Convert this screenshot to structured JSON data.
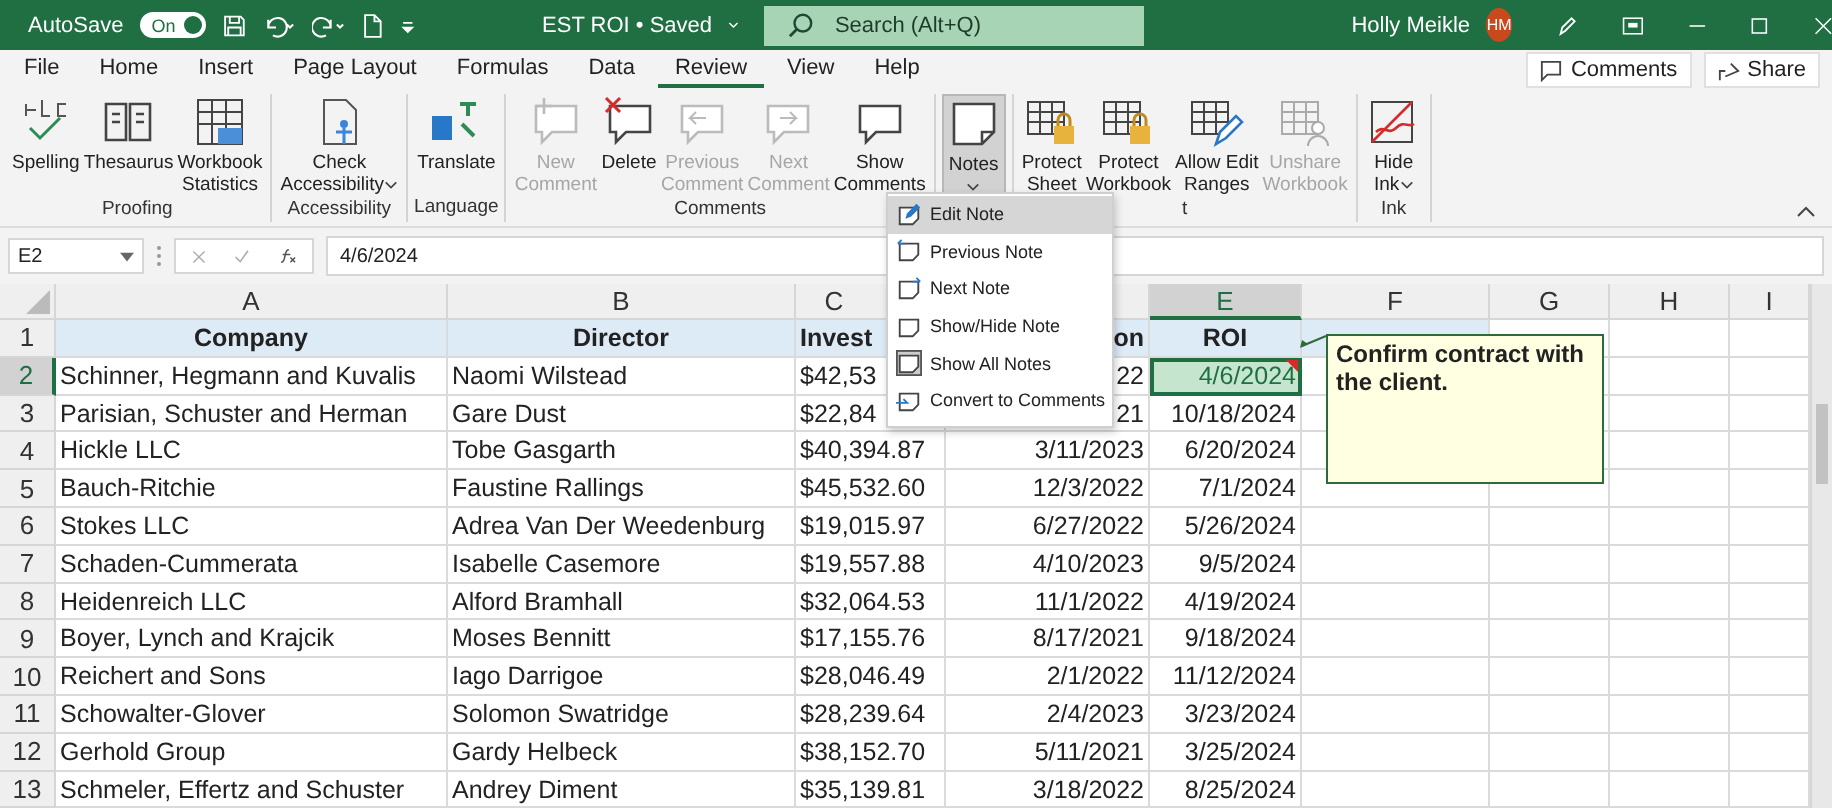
{
  "title_bar": {
    "autosave_label": "AutoSave",
    "autosave": {
      "on": true,
      "label": "On"
    },
    "doc_title": "EST ROI • Saved",
    "search_placeholder": "Search (Alt+Q)",
    "user_name": "Holly Meikle",
    "user_initials": "HM"
  },
  "tabs": [
    {
      "label": "File",
      "selected": false
    },
    {
      "label": "Home",
      "selected": false
    },
    {
      "label": "Insert",
      "selected": false
    },
    {
      "label": "Page Layout",
      "selected": false
    },
    {
      "label": "Formulas",
      "selected": false
    },
    {
      "label": "Data",
      "selected": false
    },
    {
      "label": "Review",
      "selected": true
    },
    {
      "label": "View",
      "selected": false
    },
    {
      "label": "Help",
      "selected": false
    }
  ],
  "actions": [
    {
      "label": "Comments",
      "kind": "comments"
    },
    {
      "label": "Share",
      "kind": "share"
    }
  ],
  "ribbon_groups": [
    {
      "label": "Proofing",
      "buttons": [
        {
          "lines": [
            "Spelling"
          ],
          "kind": "spelling",
          "disabled": false
        },
        {
          "lines": [
            "Thesaurus"
          ],
          "kind": "thesaurus",
          "disabled": false
        },
        {
          "lines": [
            "Workbook",
            "Statistics"
          ],
          "kind": "stats",
          "disabled": false
        }
      ]
    },
    {
      "label": "Accessibility",
      "buttons": [
        {
          "lines": [
            "Check",
            "Accessibility"
          ],
          "kind": "accessibility",
          "disabled": false,
          "dropdown": true
        }
      ]
    },
    {
      "label": "Language",
      "buttons": [
        {
          "lines": [
            "Translate"
          ],
          "kind": "translate",
          "disabled": false
        }
      ]
    },
    {
      "label": "Comments",
      "buttons": [
        {
          "lines": [
            "New",
            "Comment"
          ],
          "kind": "comment-new",
          "disabled": true
        },
        {
          "lines": [
            "Delete"
          ],
          "kind": "comment-delete",
          "disabled": false
        },
        {
          "lines": [
            "Previous",
            "Comment"
          ],
          "kind": "comment-prev",
          "disabled": true
        },
        {
          "lines": [
            "Next",
            "Comment"
          ],
          "kind": "comment-next",
          "disabled": true
        },
        {
          "lines": [
            "Show",
            "Comments"
          ],
          "kind": "comment-show",
          "disabled": false
        }
      ]
    },
    {
      "buttons": [
        {
          "lines": [
            "Notes"
          ],
          "kind": "note",
          "disabled": false,
          "dropdown": true,
          "pressed": true
        }
      ]
    },
    {
      "label": "t",
      "buttons": [
        {
          "lines": [
            "Protect",
            "Sheet"
          ],
          "kind": "protect-sheet",
          "disabled": false
        },
        {
          "lines": [
            "Protect",
            "Workbook"
          ],
          "kind": "protect-workbook",
          "disabled": false
        },
        {
          "lines": [
            "Allow Edit",
            "Ranges"
          ],
          "kind": "allow-edit",
          "disabled": false
        },
        {
          "lines": [
            "Unshare",
            "Workbook"
          ],
          "kind": "unshare",
          "disabled": true
        }
      ]
    },
    {
      "label": "Ink",
      "buttons": [
        {
          "lines": [
            "Hide",
            "Ink"
          ],
          "kind": "ink",
          "disabled": false,
          "dropdown": true
        }
      ]
    }
  ],
  "notes_menu": [
    {
      "label": "Edit Note",
      "kind": "edit",
      "selected": true
    },
    {
      "label": "Previous Note",
      "kind": "previous",
      "selected": false
    },
    {
      "label": "Next Note",
      "kind": "next",
      "selected": false
    },
    {
      "label": "Show/Hide Note",
      "kind": "show-hide",
      "selected": false
    },
    {
      "label": "Show All Notes",
      "kind": "show-all",
      "selected": false
    },
    {
      "label": "Convert to Comments",
      "kind": "convert",
      "selected": false
    }
  ],
  "formula_bar": {
    "name_box": "E2",
    "value": "4/6/2024"
  },
  "columns": [
    {
      "letter": "A",
      "selected": false
    },
    {
      "letter": "B",
      "selected": false
    },
    {
      "letter": "C",
      "selected": false
    },
    {
      "selected": false
    },
    {
      "letter": "E",
      "selected": true
    },
    {
      "letter": "F",
      "selected": false
    },
    {
      "letter": "G",
      "selected": false
    },
    {
      "letter": "H",
      "selected": false
    },
    {
      "letter": "I",
      "selected": false
    }
  ],
  "rows": [
    {
      "num": "1",
      "selected": false,
      "kind": "header",
      "cells": [
        "Company",
        "Director",
        "Invest",
        "on",
        "ROI"
      ]
    },
    {
      "num": "2",
      "selected": true,
      "cells": [
        "Schinner, Hegmann and Kuvalis",
        "Naomi Wilstead",
        "$42,53",
        "22",
        {
          "text": "4/6/2024",
          "note": true
        }
      ]
    },
    {
      "num": "3",
      "selected": false,
      "cells": [
        "Parisian, Schuster and Herman",
        "Gare Dust",
        "$22,84",
        "21",
        "10/18/2024"
      ]
    },
    {
      "num": "4",
      "selected": false,
      "cells": [
        "Hickle LLC",
        "Tobe Gasgarth",
        "$40,394.87",
        "3/11/2023",
        "6/20/2024"
      ]
    },
    {
      "num": "5",
      "selected": false,
      "cells": [
        "Bauch-Ritchie",
        "Faustine Rallings",
        "$45,532.60",
        "12/3/2022",
        "7/1/2024"
      ]
    },
    {
      "num": "6",
      "selected": false,
      "cells": [
        "Stokes LLC",
        "Adrea Van Der Weedenburg",
        "$19,015.97",
        "6/27/2022",
        "5/26/2024"
      ]
    },
    {
      "num": "7",
      "selected": false,
      "cells": [
        "Schaden-Cummerata",
        "Isabelle Casemore",
        "$19,557.88",
        "4/10/2023",
        "9/5/2024"
      ]
    },
    {
      "num": "8",
      "selected": false,
      "cells": [
        "Heidenreich LLC",
        "Alford Bramhall",
        "$32,064.53",
        "11/1/2022",
        "4/19/2024"
      ]
    },
    {
      "num": "9",
      "selected": false,
      "cells": [
        "Boyer, Lynch and Krajcik",
        "Moses Bennitt",
        "$17,155.76",
        "8/17/2021",
        "9/18/2024"
      ]
    },
    {
      "num": "10",
      "selected": false,
      "cells": [
        "Reichert and Sons",
        "Iago Darrigoe",
        "$28,046.49",
        "2/1/2022",
        "11/12/2024"
      ]
    },
    {
      "num": "11",
      "selected": false,
      "cells": [
        "Schowalter-Glover",
        "Solomon Swatridge",
        "$28,239.64",
        "2/4/2023",
        "3/23/2024"
      ]
    },
    {
      "num": "12",
      "selected": false,
      "cells": [
        "Gerhold Group",
        "Gardy Helbeck",
        "$38,152.70",
        "5/11/2021",
        "3/25/2024"
      ]
    },
    {
      "num": "13",
      "selected": false,
      "cells": [
        "Schmeler, Effertz and Schuster",
        "Andrey Diment",
        "$35,139.81",
        "3/18/2022",
        "8/25/2024"
      ]
    }
  ],
  "note": {
    "text": "Confirm contract with the client."
  }
}
